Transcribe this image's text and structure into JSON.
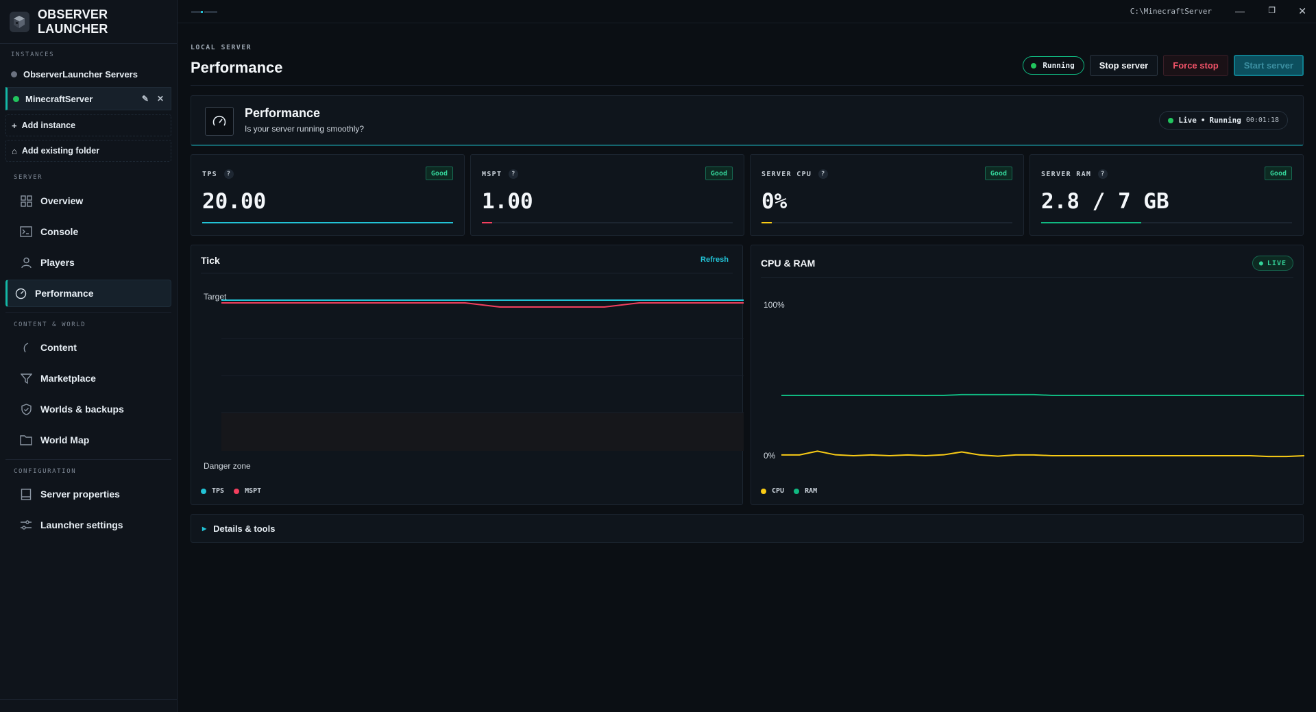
{
  "app": {
    "title": "OBSERVER LAUNCHER",
    "path": "C:\\MinecraftServer"
  },
  "sidebar": {
    "instances_label": "INSTANCES",
    "instances": [
      {
        "label": "ObserverLauncher Servers",
        "status_color": "#6b7280"
      },
      {
        "label": "MinecraftServer",
        "status_color": "#22c55e",
        "active": true
      }
    ],
    "add_instance": "Add instance",
    "add_folder": "Add existing folder",
    "server_label": "SERVER",
    "server_items": [
      {
        "label": "Overview",
        "icon": "grid-icon"
      },
      {
        "label": "Console",
        "icon": "terminal-icon"
      },
      {
        "label": "Players",
        "icon": "user-icon"
      },
      {
        "label": "Performance",
        "icon": "gauge-icon",
        "active": true
      }
    ],
    "content_label": "CONTENT & WORLD",
    "content_items": [
      {
        "label": "Content",
        "icon": "leaf-icon"
      },
      {
        "label": "Marketplace",
        "icon": "filter-icon"
      },
      {
        "label": "Worlds & backups",
        "icon": "shield-icon"
      },
      {
        "label": "World Map",
        "icon": "folder-icon"
      }
    ],
    "config_label": "CONFIGURATION",
    "config_items": [
      {
        "label": "Server properties",
        "icon": "document-icon"
      },
      {
        "label": "Launcher settings",
        "icon": "sliders-icon"
      }
    ]
  },
  "header": {
    "breadcrumb": "LOCAL SERVER",
    "title": "Performance",
    "status": "Running",
    "stop_label": "Stop server",
    "force_label": "Force stop",
    "start_label": "Start server"
  },
  "hero": {
    "title": "Performance",
    "subtitle": "Is your server running smoothly?",
    "live_label": "Live",
    "live_state": "Running",
    "uptime": "00:01:18"
  },
  "metrics": [
    {
      "label": "TPS",
      "badge": "Good",
      "value": "20.00",
      "fill": 1.0,
      "color": "#22c3d6"
    },
    {
      "label": "MSPT",
      "badge": "Good",
      "value": "1.00",
      "fill": 0.04,
      "color": "#f43f5e"
    },
    {
      "label": "SERVER CPU",
      "badge": "Good",
      "value": "0%",
      "fill": 0.04,
      "color": "#facc15"
    },
    {
      "label": "SERVER RAM",
      "badge": "Good",
      "value": "2.8 / 7 GB",
      "fill": 0.4,
      "color": "#10b981"
    }
  ],
  "tick_chart": {
    "title": "Tick",
    "refresh_label": "Refresh",
    "target_label": "Target",
    "danger_label": "Danger zone",
    "legend": [
      {
        "name": "TPS",
        "color": "#22c3d6"
      },
      {
        "name": "MSPT",
        "color": "#f43f5e"
      }
    ]
  },
  "resource_chart": {
    "title": "CPU & RAM",
    "live_badge": "LIVE",
    "y_top": "100%",
    "y_bottom": "0%",
    "legend": [
      {
        "name": "CPU",
        "color": "#facc15"
      },
      {
        "name": "RAM",
        "color": "#10b981"
      }
    ]
  },
  "chart_data": [
    {
      "type": "line",
      "title": "Tick",
      "series": [
        {
          "name": "TPS",
          "values": [
            20,
            20,
            20,
            20,
            20,
            20,
            20,
            20,
            20,
            20,
            20,
            20,
            20,
            20,
            20,
            20
          ]
        },
        {
          "name": "MSPT",
          "values": [
            1.0,
            1.0,
            1.0,
            1.0,
            1.0,
            1.0,
            1.0,
            1.0,
            0.6,
            0.6,
            0.6,
            0.6,
            1.0,
            1.0,
            1.0,
            1.0
          ]
        }
      ]
    },
    {
      "type": "line",
      "title": "CPU & RAM",
      "ylim": [
        0,
        100
      ],
      "series": [
        {
          "name": "CPU",
          "values": [
            0.5,
            0.5,
            3,
            0.6,
            0,
            0.5,
            0,
            0.5,
            0,
            0.6,
            2.5,
            0.5,
            -0.3,
            0.5,
            0.5,
            0,
            0,
            0,
            0,
            0,
            0,
            0,
            0,
            0,
            0,
            0,
            0,
            -0.5,
            -0.5,
            0
          ]
        },
        {
          "name": "RAM",
          "values": [
            40,
            40,
            40,
            40,
            40,
            40,
            40,
            40,
            40,
            40,
            40.5,
            40.5,
            40.5,
            40.5,
            40.5,
            40,
            40,
            40,
            40,
            40,
            40,
            40,
            40,
            40,
            40,
            40,
            40,
            40,
            40,
            40
          ]
        }
      ]
    }
  ]
}
